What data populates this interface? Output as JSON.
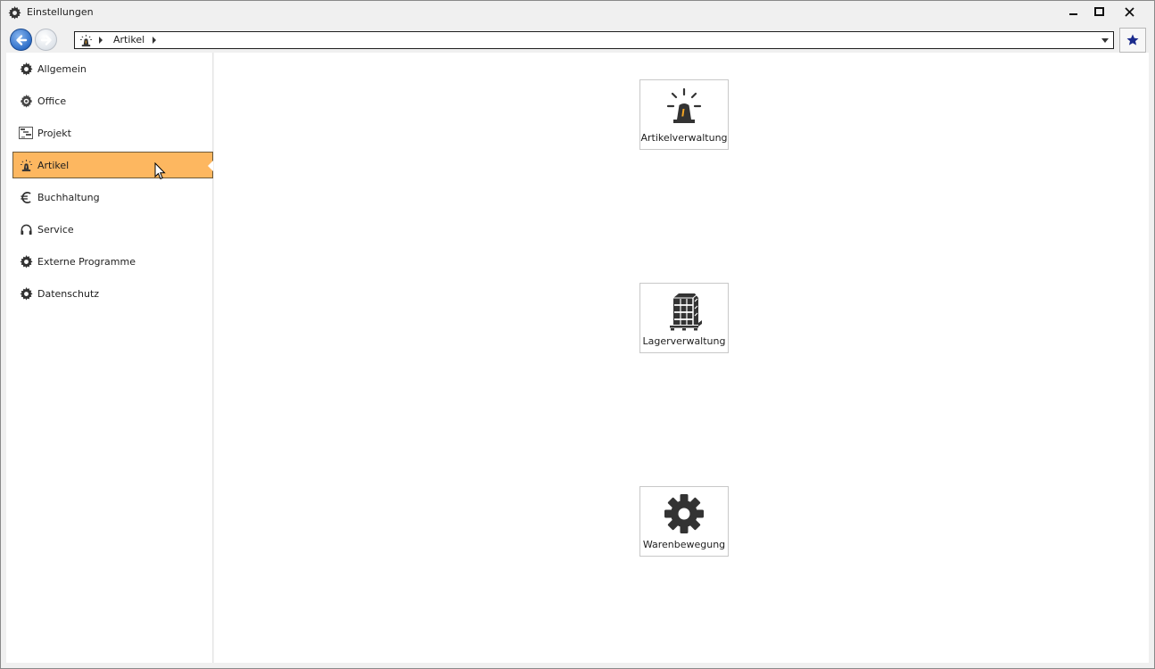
{
  "window": {
    "title": "Einstellungen",
    "controls": {
      "minimize": "minimize-icon",
      "maximize": "maximize-icon",
      "close": "close-icon"
    }
  },
  "nav": {
    "back_icon": "back-arrow-icon",
    "forward_icon": "forward-arrow-icon",
    "breadcrumb": {
      "root_icon": "siren-icon",
      "current": "Artikel"
    },
    "favorite_icon": "star-icon"
  },
  "sidebar": {
    "items": [
      {
        "label": "Allgemein",
        "icon": "gear-icon"
      },
      {
        "label": "Office",
        "icon": "office-gear-icon"
      },
      {
        "label": "Projekt",
        "icon": "project-icon"
      },
      {
        "label": "Artikel",
        "icon": "siren-icon",
        "active": true
      },
      {
        "label": "Buchhaltung",
        "icon": "euro-icon"
      },
      {
        "label": "Service",
        "icon": "headset-icon"
      },
      {
        "label": "Externe Programme",
        "icon": "gear-icon"
      },
      {
        "label": "Datenschutz",
        "icon": "gear-icon"
      }
    ]
  },
  "tiles": [
    {
      "label": "Artikelverwaltung",
      "icon": "siren-icon"
    },
    {
      "label": "Lagerverwaltung",
      "icon": "pallet-boxes-icon"
    },
    {
      "label": "Warenbewegung",
      "icon": "gear-icon"
    }
  ],
  "colors": {
    "active_item": "#fdb760",
    "icon_dark": "#333333",
    "accent_blue": "#2f6fc8",
    "star": "#1a2a8c"
  }
}
